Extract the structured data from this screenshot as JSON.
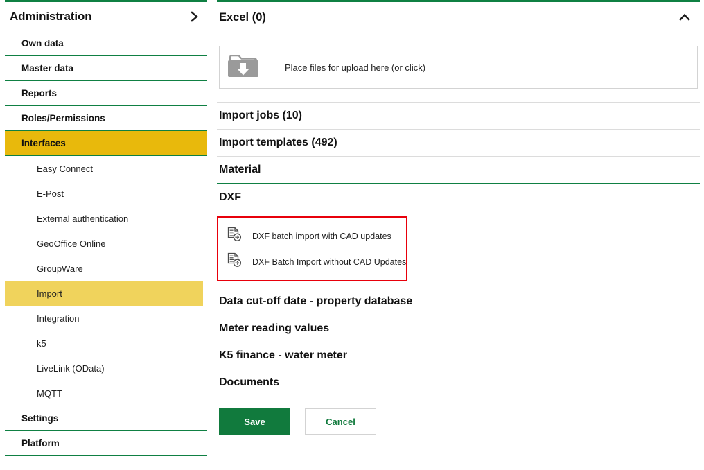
{
  "theme": {
    "accent_green": "#0f8043",
    "button_green": "#117a3d",
    "highlight_gold": "#e8b90c",
    "highlight_yellow": "#f0d35c",
    "alert_red": "#e8000b",
    "divider_gray": "#dcdcdc"
  },
  "sidebar": {
    "title": "Administration",
    "expand_icon": "chevron-right-icon",
    "items": [
      {
        "label": "Own data",
        "level": "top",
        "state": "normal"
      },
      {
        "label": "Master data",
        "level": "top",
        "state": "normal"
      },
      {
        "label": "Reports",
        "level": "top",
        "state": "normal"
      },
      {
        "label": "Roles/Permissions",
        "level": "top",
        "state": "normal"
      },
      {
        "label": "Interfaces",
        "level": "top",
        "state": "active"
      },
      {
        "label": "Easy Connect",
        "level": "sub",
        "state": "normal"
      },
      {
        "label": "E-Post",
        "level": "sub",
        "state": "normal"
      },
      {
        "label": "External authentication",
        "level": "sub",
        "state": "normal"
      },
      {
        "label": "GeoOffice Online",
        "level": "sub",
        "state": "normal"
      },
      {
        "label": "GroupWare",
        "level": "sub",
        "state": "normal"
      },
      {
        "label": "Import",
        "level": "sub",
        "state": "selected"
      },
      {
        "label": "Integration",
        "level": "sub",
        "state": "normal"
      },
      {
        "label": "k5",
        "level": "sub",
        "state": "normal"
      },
      {
        "label": "LiveLink (OData)",
        "level": "sub",
        "state": "normal"
      },
      {
        "label": "MQTT",
        "level": "sub",
        "state": "normal"
      },
      {
        "label": "Settings",
        "level": "top",
        "state": "normal"
      },
      {
        "label": "Platform",
        "level": "top",
        "state": "normal"
      }
    ]
  },
  "main": {
    "panel": {
      "title": "Excel (0)",
      "collapse_icon": "chevron-up-icon"
    },
    "dropzone": {
      "icon": "folder-download-icon",
      "label": "Place files for upload here (or click)"
    },
    "sections": [
      {
        "label": "Import jobs (10)"
      },
      {
        "label": "Import templates (492)"
      },
      {
        "label": "Material"
      },
      {
        "label": "DXF"
      }
    ],
    "dxf_actions": {
      "highlighted": true,
      "items": [
        {
          "icon": "document-import-icon",
          "label": "DXF batch import with CAD updates"
        },
        {
          "icon": "document-import-icon",
          "label": "DXF Batch Import without CAD Updates"
        }
      ]
    },
    "sections_lower": [
      {
        "label": "Data cut-off date - property database"
      },
      {
        "label": "Meter reading values"
      },
      {
        "label": "K5 finance - water meter"
      },
      {
        "label": "Documents"
      }
    ],
    "buttons": {
      "save_label": "Save",
      "cancel_label": "Cancel"
    }
  }
}
